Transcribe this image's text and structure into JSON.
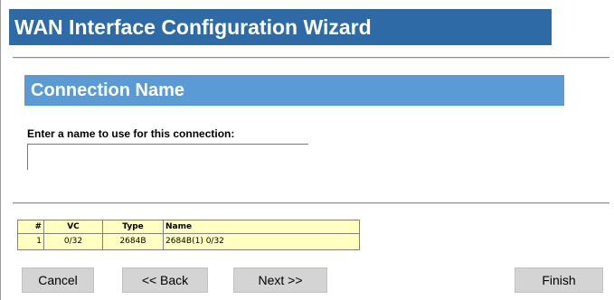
{
  "header": {
    "title": "WAN Interface Configuration Wizard"
  },
  "section": {
    "title": "Connection Name"
  },
  "form": {
    "prompt": "Enter a name to use for this connection:",
    "name_value": "",
    "name_placeholder": ""
  },
  "table": {
    "headers": {
      "num": "#",
      "vc": "VC",
      "type": "Type",
      "name": "Name"
    },
    "rows": [
      {
        "num": "1",
        "vc": "0/32",
        "type": "2684B",
        "name": "2684B(1) 0/32"
      }
    ]
  },
  "buttons": {
    "cancel": "Cancel",
    "back": "<< Back",
    "next": "Next >>",
    "finish": "Finish"
  },
  "colors": {
    "title_bar": "#2e6aa6",
    "section_bar": "#5b9bd5",
    "table_background": "#ffffc0",
    "button_face": "#d4d4d4"
  }
}
